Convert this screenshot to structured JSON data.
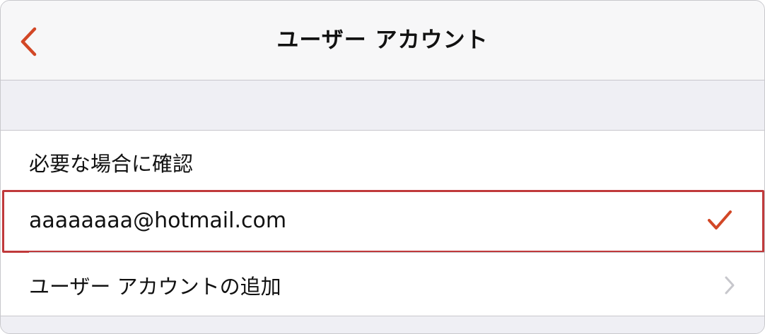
{
  "nav": {
    "title": "ユーザー アカウント",
    "back_icon": "chevron-left-icon"
  },
  "list": {
    "items": [
      {
        "label": "必要な場合に確認",
        "selected": false,
        "accessory": "none"
      },
      {
        "label": "aaaaaaaa@hotmail.com",
        "selected": true,
        "accessory": "checkmark-icon"
      },
      {
        "label": "ユーザー アカウントの追加",
        "selected": false,
        "accessory": "chevron-right-icon"
      }
    ]
  },
  "colors": {
    "accent": "#d24726",
    "highlight_border": "#c0393b",
    "chevron": "#c7c7cc",
    "background": "#efeff4"
  }
}
